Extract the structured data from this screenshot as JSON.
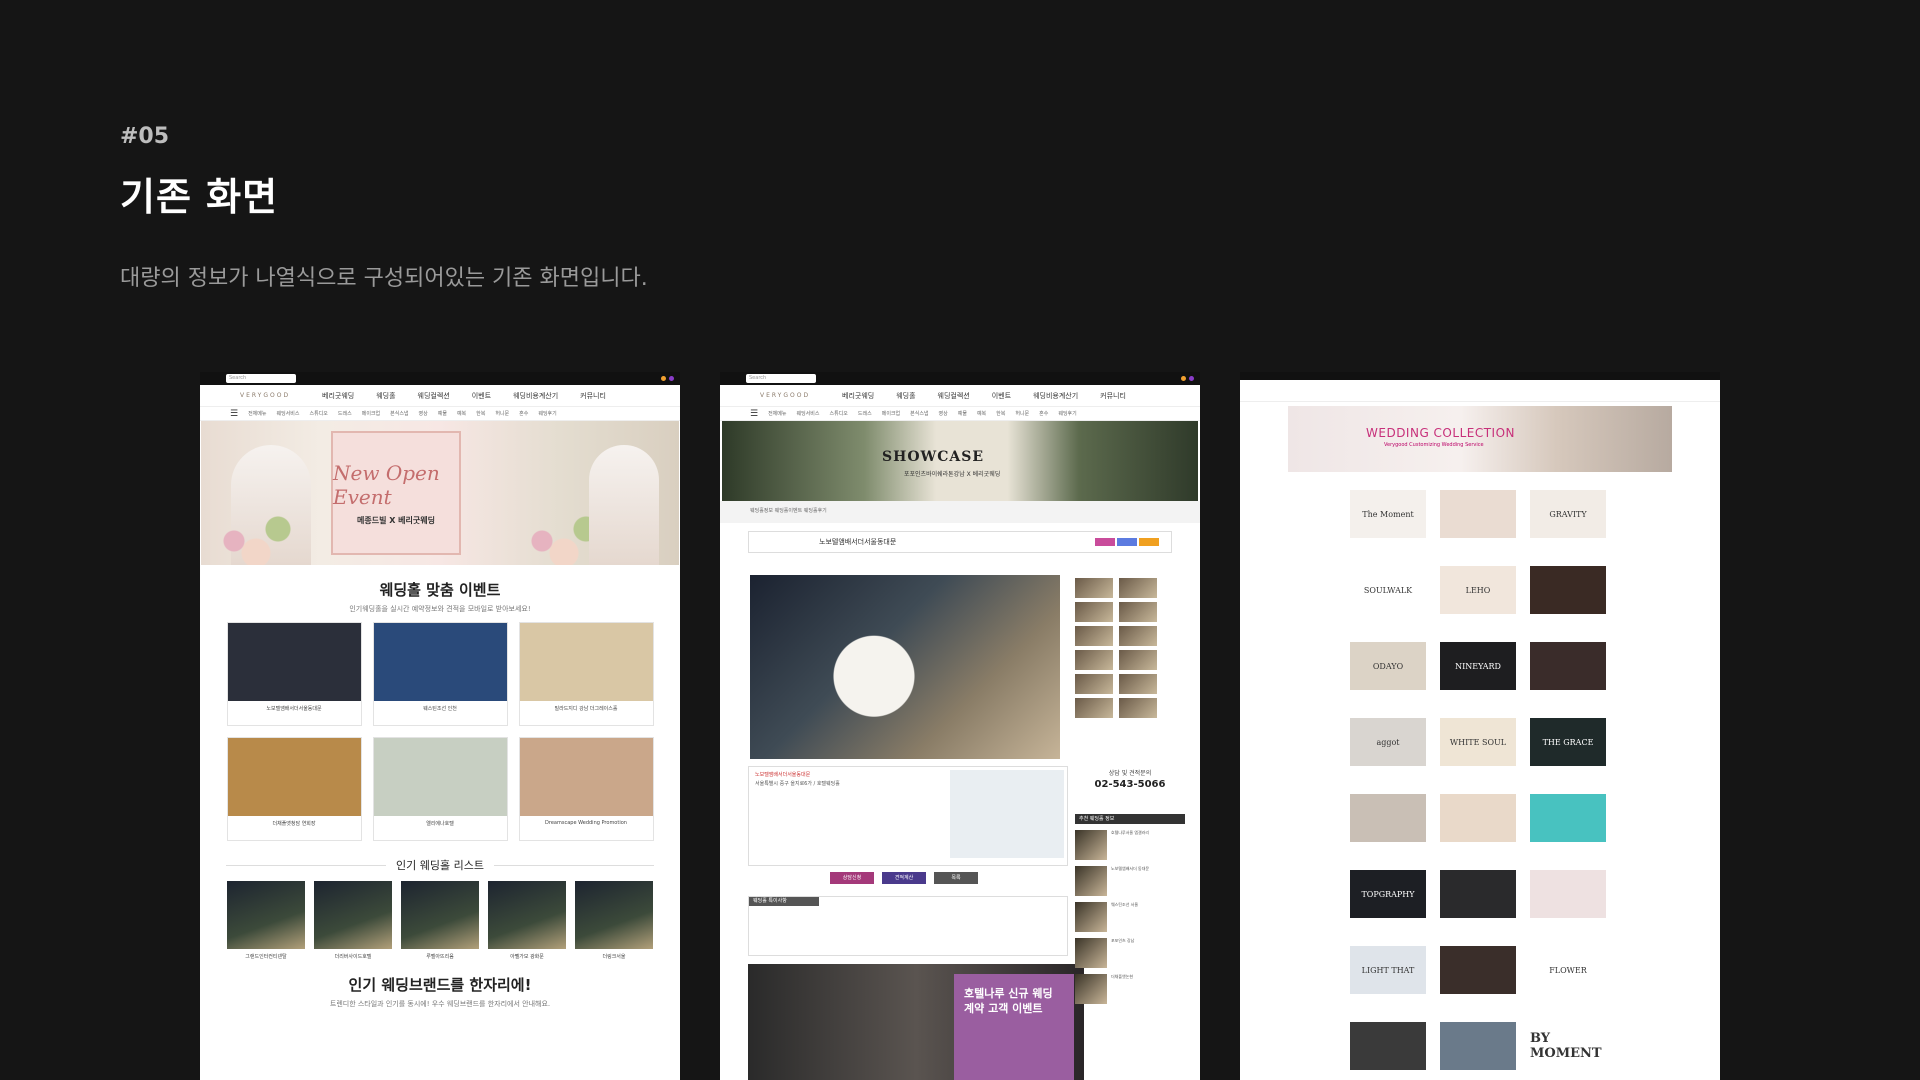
{
  "header": {
    "number": "#05",
    "title": "기존 화면",
    "description": "대량의 정보가 나열식으로 구성되어있는 기존 화면입니다."
  },
  "shot1": {
    "search_placeholder": "Search",
    "logo": "VERYGOOD",
    "menu": [
      "베리굿웨딩",
      "웨딩홀",
      "웨딩컬렉션",
      "이벤트",
      "웨딩비용계산기",
      "커뮤니티"
    ],
    "sub": [
      "전체메뉴",
      "웨딩서비스",
      "스튜디오",
      "드레스",
      "메이크업",
      "본식스냅",
      "영상",
      "예물",
      "예복",
      "한복",
      "허니문",
      "혼수",
      "웨딩후기"
    ],
    "hero_script": "New Open Event",
    "hero_caption": "메종드빌 X 베리굿웨딩",
    "section1_title": "웨딩홀 맞춤 이벤트",
    "section1_sub": "인기웨딩홀을 실시간 예약정보와 견적을 모바일로 받아보세요!",
    "tiles": [
      {
        "t": "노보텔앰배서더서울동대문",
        "c": "#2b2f3a"
      },
      {
        "t": "웨스틴조선 인천",
        "c": "#2a4a7a"
      },
      {
        "t": "빌라드지디 강남 더그레이스홀",
        "c": "#d9c7a5"
      },
      {
        "t": "더채플앳청담 연회장",
        "c": "#b88a4a"
      },
      {
        "t": "엘리에나호텔",
        "c": "#c7cfc2"
      },
      {
        "t": "Dreamscape Wedding Promotion",
        "c": "#caa78a"
      }
    ],
    "section2_title": "인기 웨딩홀 리스트",
    "list": [
      "그랜드인터컨티넨탈",
      "더리버사이드호텔",
      "루벨아뜨리움",
      "아펠가모 광화문",
      "더링크서울"
    ],
    "section3_title": "인기 웨딩브랜드를 한자리에!",
    "section3_sub": "트렌디한 스타일과 인기를 동시에! 우수 웨딩브랜드를 한자리에서 안내해요."
  },
  "shot2": {
    "search_placeholder": "Search",
    "logo": "VERYGOOD",
    "menu": [
      "베리굿웨딩",
      "웨딩홀",
      "웨딩컬렉션",
      "이벤트",
      "웨딩비용계산기",
      "커뮤니티"
    ],
    "sub": [
      "전체메뉴",
      "웨딩서비스",
      "스튜디오",
      "드레스",
      "메이크업",
      "본식스냅",
      "영상",
      "예물",
      "예복",
      "한복",
      "허니문",
      "혼수",
      "웨딩후기"
    ],
    "hero_title": "SHOWCASE",
    "hero_sub": "포포인츠바이쉐라톤강남 X 베리굿웨딩",
    "crumb": "웨딩홀정보  웨딩홀이벤트  웨딩홀후기",
    "venue_name": "노보텔앰배서더서울동대문",
    "venue_addr": "서울특별시 중구 을지로6가 / 호텔웨딩홀",
    "phone_label": "상담 및 견적문의",
    "phone": "02-543-5066",
    "buttons": [
      "상담신청",
      "견적계산",
      "목록"
    ],
    "notice_label": "웨딩홀 특이사항",
    "event_title": "호텔나루 신규 웨딩 계약 고객 이벤트",
    "side_head": "추천 웨딩홀 정보",
    "side_items": [
      "호텔나루서울 엠갤러리",
      "노보텔앰배서더 동대문",
      "웨스틴조선 서울",
      "포포인츠 강남",
      "더채플앳논현"
    ]
  },
  "shot3": {
    "banner_title": "WEDDING COLLECTION",
    "banner_sub": "Verygood Customizing Wedding Service",
    "brands": [
      "The Moment",
      "",
      "GRAVITY",
      "SOULWALK",
      "LEHO",
      "",
      "ODAYO",
      "NINEYARD",
      "",
      "aggot",
      "WHITE SOUL",
      "THE GRACE",
      "",
      "",
      "",
      "TOPGRAPHY",
      "",
      "",
      "LIGHT THAT",
      "",
      "FLOWER",
      "",
      "",
      "BY MOMENT"
    ]
  },
  "colors": {
    "background": "#151515",
    "accent_pink": "#c7307a",
    "event_purple": "#9a5ea0"
  }
}
